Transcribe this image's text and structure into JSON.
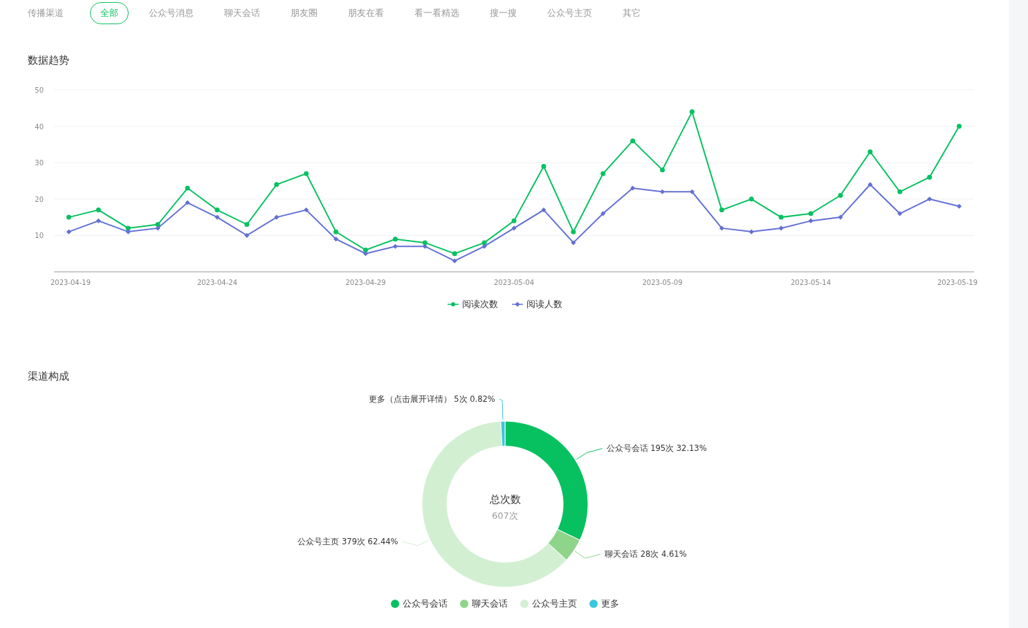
{
  "tabs_label": "传播渠道",
  "tabs": [
    {
      "label": "全部",
      "selected": true
    },
    {
      "label": "公众号消息",
      "selected": false
    },
    {
      "label": "聊天会话",
      "selected": false
    },
    {
      "label": "朋友圈",
      "selected": false
    },
    {
      "label": "朋友在看",
      "selected": false
    },
    {
      "label": "看一看精选",
      "selected": false
    },
    {
      "label": "搜一搜",
      "selected": false
    },
    {
      "label": "公众号主页",
      "selected": false
    },
    {
      "label": "其它",
      "selected": false
    }
  ],
  "trend": {
    "title": "数据趋势",
    "chart_data": {
      "type": "line",
      "categories": [
        "2023-04-19",
        null,
        null,
        null,
        null,
        "2023-04-24",
        null,
        null,
        null,
        null,
        "2023-04-29",
        null,
        null,
        null,
        null,
        "2023-05-04",
        null,
        null,
        null,
        null,
        "2023-05-09",
        null,
        null,
        null,
        null,
        "2023-05-14",
        null,
        null,
        null,
        null,
        "2023-05-19"
      ],
      "grid": true,
      "legend": true,
      "ylim": [
        0,
        50
      ],
      "yticks": [
        10,
        20,
        30,
        40,
        50
      ],
      "series": [
        {
          "name": "阅读次数",
          "color": "#07c160",
          "marker": "circle",
          "values": [
            15,
            17,
            12,
            13,
            23,
            17,
            13,
            24,
            27,
            11,
            6,
            9,
            8,
            5,
            8,
            14,
            29,
            11,
            27,
            36,
            28,
            44,
            17,
            20,
            15,
            16,
            21,
            33,
            22,
            26,
            40
          ]
        },
        {
          "name": "阅读人数",
          "color": "#6270d4",
          "marker": "diamond",
          "values": [
            11,
            14,
            11,
            12,
            19,
            15,
            10,
            15,
            17,
            9,
            5,
            7,
            7,
            3,
            7,
            12,
            17,
            8,
            16,
            23,
            22,
            22,
            12,
            11,
            12,
            14,
            15,
            24,
            16,
            20,
            18
          ]
        }
      ]
    }
  },
  "channels": {
    "title": "渠道构成",
    "center_title": "总次数",
    "center_value": "607次",
    "chart_data": {
      "type": "donut",
      "categories": [
        "公众号会话",
        "聊天会话",
        "公众号主页",
        "更多"
      ],
      "values": [
        32.13,
        4.61,
        62.44,
        0.82
      ],
      "legend": true
    },
    "slice_labels": [
      "公众号会话 195次 32.13%",
      "聊天会话 28次 4.61%",
      "公众号主页 379次 62.44%",
      "更多（点击展开详情） 5次 0.82%"
    ],
    "slices": [
      {
        "color": "#07c160"
      },
      {
        "color": "#8ed48b"
      },
      {
        "color": "#d2efd2"
      },
      {
        "color": "#3cc6de"
      }
    ]
  }
}
